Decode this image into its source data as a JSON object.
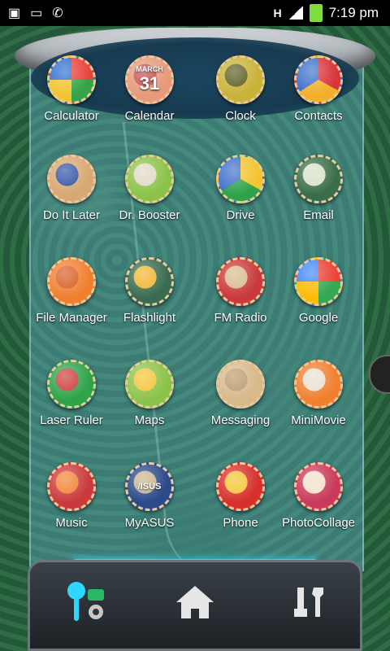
{
  "status_bar": {
    "time": "7:19 pm",
    "network_label": "H",
    "icons": [
      "image-icon",
      "message-icon",
      "missed-call-icon",
      "signal-icon",
      "battery-charging-icon"
    ]
  },
  "apps": [
    {
      "label": "Calculator",
      "icon": "calculator-icon",
      "colors": [
        "#e8433a",
        "#35a34a",
        "#f4c430",
        "#2d6fd1"
      ]
    },
    {
      "label": "Calendar",
      "icon": "calendar-icon",
      "text": "MARCH",
      "day": "31",
      "colors": [
        "#e79a7a",
        "#c84b4b"
      ]
    },
    {
      "label": "Clock",
      "icon": "clock-icon",
      "colors": [
        "#c9b23a",
        "#5a5a1e"
      ]
    },
    {
      "label": "Contacts",
      "icon": "contacts-icon",
      "colors": [
        "#d9343b",
        "#f2b02a",
        "#3c6fc9"
      ]
    },
    {
      "label": "Do It Later",
      "icon": "checkmark-icon",
      "colors": [
        "#d7a873",
        "#2d4fa3"
      ]
    },
    {
      "label": "Dr. Booster",
      "icon": "booster-icon",
      "colors": [
        "#8bc34a",
        "#e0d8c8"
      ]
    },
    {
      "label": "Drive",
      "icon": "drive-icon",
      "colors": [
        "#f4c430",
        "#2fa34a",
        "#3c6fc9"
      ]
    },
    {
      "label": "Email",
      "icon": "email-icon",
      "colors": [
        "#3a6e4a",
        "#d7e0c8"
      ]
    },
    {
      "label": "File Manager",
      "icon": "folder-icon",
      "colors": [
        "#f08030",
        "#d75a20"
      ]
    },
    {
      "label": "Flashlight",
      "icon": "flashlight-icon",
      "colors": [
        "#3a6b50",
        "#f3b22b"
      ]
    },
    {
      "label": "FM Radio",
      "icon": "radio-icon",
      "colors": [
        "#c93a3a",
        "#d7b98a"
      ]
    },
    {
      "label": "Google",
      "icon": "google-icon",
      "colors": [
        "#ea4335",
        "#34a853",
        "#fbbc05",
        "#4285f4"
      ]
    },
    {
      "label": "Laser Ruler",
      "icon": "ruler-icon",
      "colors": [
        "#2fa34a",
        "#c93a3a"
      ]
    },
    {
      "label": "Maps",
      "icon": "maps-icon",
      "colors": [
        "#8bc34a",
        "#f4c430"
      ]
    },
    {
      "label": "Messaging",
      "icon": "envelope-icon",
      "colors": [
        "#d7b98a",
        "#b99a6a"
      ]
    },
    {
      "label": "MiniMovie",
      "icon": "minimovie-icon",
      "colors": [
        "#f08030",
        "#e9e0d0"
      ]
    },
    {
      "label": "Music",
      "icon": "music-icon",
      "colors": [
        "#c93a3a",
        "#f08030"
      ]
    },
    {
      "label": "MyASUS",
      "icon": "myasus-icon",
      "text": "/ISUS",
      "colors": [
        "#2a4a8a",
        "#c9b28a"
      ]
    },
    {
      "label": "Phone",
      "icon": "phone-icon",
      "colors": [
        "#d7302b",
        "#f4c430"
      ]
    },
    {
      "label": "PhotoCollage",
      "icon": "photocollage-icon",
      "colors": [
        "#c93a5a",
        "#f3e0c8"
      ]
    }
  ],
  "dock": {
    "buttons": [
      {
        "name": "launcher-settings-button",
        "icon": "android-settings-icon"
      },
      {
        "name": "home-button",
        "icon": "home-icon"
      },
      {
        "name": "tools-button",
        "icon": "tools-icon"
      }
    ],
    "accent": "#2fd7ff"
  }
}
